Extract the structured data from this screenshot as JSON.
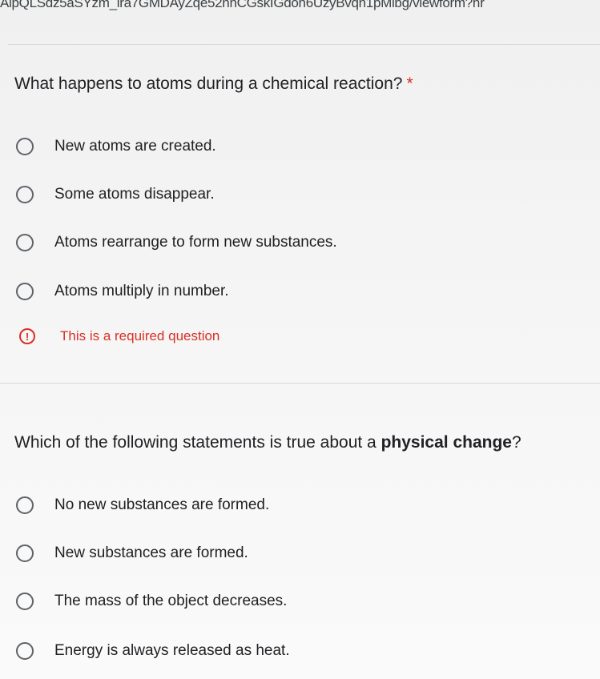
{
  "browser": {
    "url_text": "AlpQLSdz5aSYzm_lra7GMDAyZqe52nhCGskIGdoh6UzyBvqn1pMlbg/viewform?hr"
  },
  "questions": [
    {
      "title": "What happens to atoms during a chemical reaction?",
      "required_marker": "*",
      "options": [
        "New atoms are created.",
        "Some atoms disappear.",
        "Atoms rearrange to form new substances.",
        "Atoms multiply in number."
      ],
      "error_message": "This is a required question"
    },
    {
      "title_prefix": "Which of the following statements is true about a ",
      "title_emphasis": "physical change",
      "title_suffix": "?",
      "options": [
        "No new substances are formed.",
        "New substances are formed.",
        "The mass of the object decreases.",
        "Energy is always released as heat."
      ]
    }
  ],
  "icons": {
    "radio": "radio-unselected-icon",
    "error": "exclamation-circle-icon"
  },
  "colors": {
    "text": "#202124",
    "error": "#d93025",
    "radio_border": "#5f6368"
  }
}
